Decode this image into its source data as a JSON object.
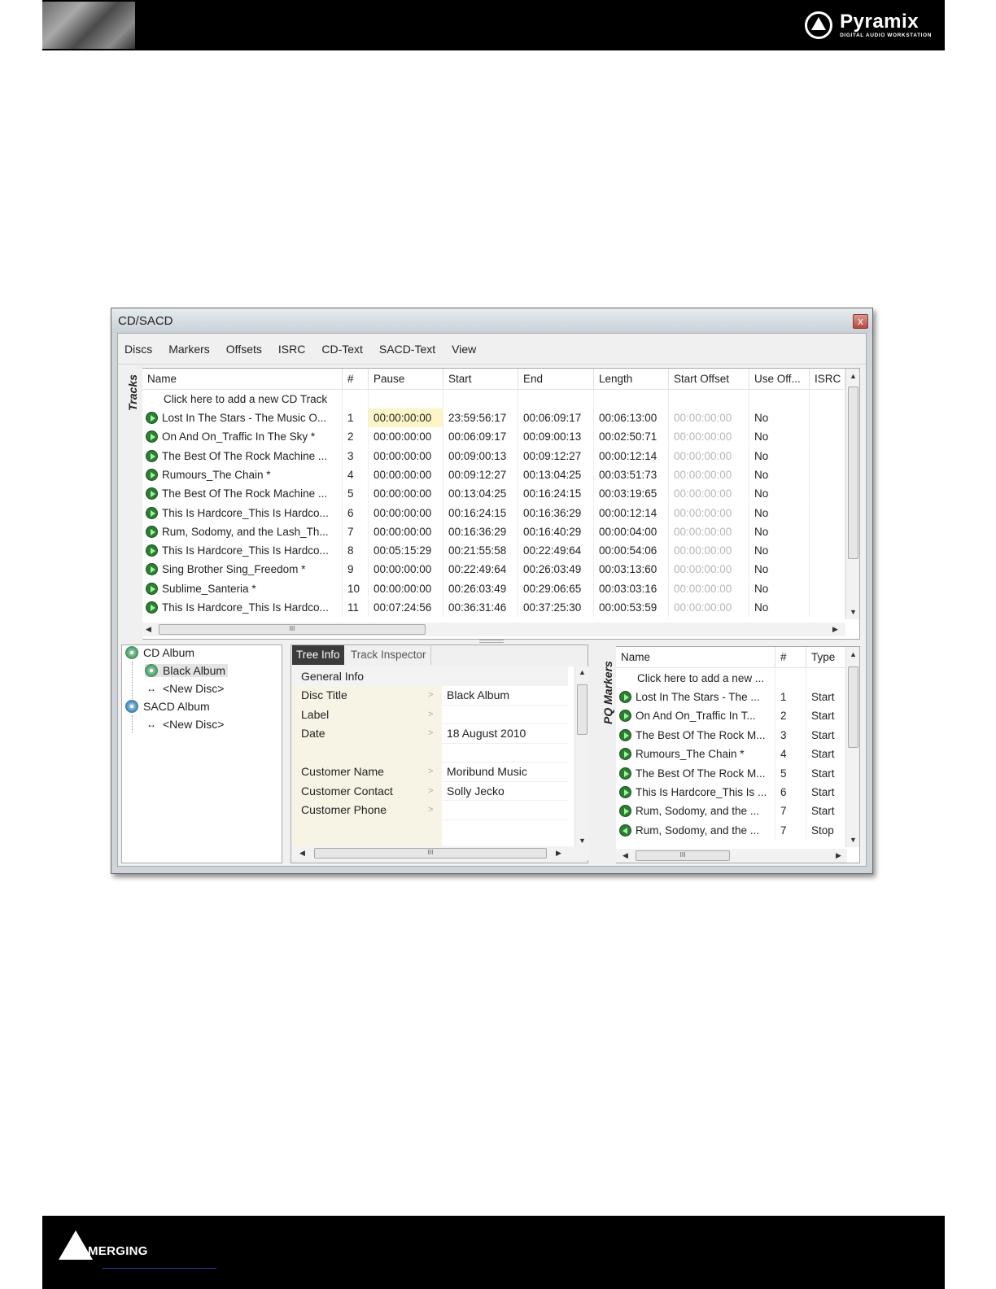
{
  "brand": {
    "product": "Pyramix",
    "product_sub": "DIGITAL AUDIO WORKSTATION",
    "company": "MERGING"
  },
  "window": {
    "title": "CD/SACD",
    "close": "x"
  },
  "menu": [
    "Discs",
    "Markers",
    "Offsets",
    "ISRC",
    "CD-Text",
    "SACD-Text",
    "View"
  ],
  "tracks": {
    "label": "Tracks",
    "columns": [
      "Name",
      "#",
      "Pause",
      "Start",
      "End",
      "Length",
      "Start Offset",
      "Use Off...",
      "ISRC"
    ],
    "add_row": "Click here to add a new CD Track",
    "rows": [
      [
        "Lost In The Stars - The Music O...",
        "1",
        "00:00:00:00",
        "23:59:56:17",
        "00:06:09:17",
        "00:06:13:00",
        "00:00:00:00",
        "No"
      ],
      [
        "On And On_Traffic In The Sky *",
        "2",
        "00:00:00:00",
        "00:06:09:17",
        "00:09:00:13",
        "00:02:50:71",
        "00:00:00:00",
        "No"
      ],
      [
        "The Best Of The Rock Machine ...",
        "3",
        "00:00:00:00",
        "00:09:00:13",
        "00:09:12:27",
        "00:00:12:14",
        "00:00:00:00",
        "No"
      ],
      [
        "Rumours_The Chain *",
        "4",
        "00:00:00:00",
        "00:09:12:27",
        "00:13:04:25",
        "00:03:51:73",
        "00:00:00:00",
        "No"
      ],
      [
        "The Best Of The Rock Machine ...",
        "5",
        "00:00:00:00",
        "00:13:04:25",
        "00:16:24:15",
        "00:03:19:65",
        "00:00:00:00",
        "No"
      ],
      [
        "This Is Hardcore_This Is Hardco...",
        "6",
        "00:00:00:00",
        "00:16:24:15",
        "00:16:36:29",
        "00:00:12:14",
        "00:00:00:00",
        "No"
      ],
      [
        "Rum, Sodomy, and the Lash_Th...",
        "7",
        "00:00:00:00",
        "00:16:36:29",
        "00:16:40:29",
        "00:00:04:00",
        "00:00:00:00",
        "No"
      ],
      [
        "This Is Hardcore_This Is Hardco...",
        "8",
        "00:05:15:29",
        "00:21:55:58",
        "00:22:49:64",
        "00:00:54:06",
        "00:00:00:00",
        "No"
      ],
      [
        "Sing Brother Sing_Freedom *",
        "9",
        "00:00:00:00",
        "00:22:49:64",
        "00:26:03:49",
        "00:03:13:60",
        "00:00:00:00",
        "No"
      ],
      [
        "Sublime_Santeria *",
        "10",
        "00:00:00:00",
        "00:26:03:49",
        "00:29:06:65",
        "00:03:03:16",
        "00:00:00:00",
        "No"
      ],
      [
        "This Is Hardcore_This Is Hardco...",
        "11",
        "00:07:24:56",
        "00:36:31:46",
        "00:37:25:30",
        "00:00:53:59",
        "00:00:00:00",
        "No"
      ]
    ],
    "hscroll_thumb": "III"
  },
  "tree": {
    "items": [
      {
        "label": "CD Album",
        "icon": "cd-album-icon"
      },
      {
        "label": "Black Album",
        "icon": "disc-icon"
      },
      {
        "label": "<New Disc>",
        "icon": "new-disc-icon"
      },
      {
        "label": "SACD Album",
        "icon": "sacd-album-icon"
      },
      {
        "label": "<New Disc>",
        "icon": "new-disc-icon"
      }
    ]
  },
  "inspector": {
    "tabs": [
      "Tree Info",
      "Track Inspector"
    ],
    "section": "General Info",
    "rows": [
      {
        "key": "Disc Title",
        "value": "Black Album"
      },
      {
        "key": "Label",
        "value": ""
      },
      {
        "key": "Date",
        "value": "18 August 2010"
      },
      {
        "key": "",
        "value": ""
      },
      {
        "key": "Customer Name",
        "value": "Moribund Music"
      },
      {
        "key": "Customer Contact",
        "value": "Solly Jecko"
      },
      {
        "key": "Customer Phone",
        "value": ""
      }
    ],
    "arrow": ">",
    "hscroll_thumb": "III"
  },
  "pq": {
    "label": "PQ Markers",
    "columns": [
      "Name",
      "#",
      "Type"
    ],
    "add_row": "Click here to add a new ...",
    "rows": [
      [
        "Lost In The Stars - The ...",
        "1",
        "Start"
      ],
      [
        "On And On_Traffic In T...",
        "2",
        "Start"
      ],
      [
        "The Best Of The Rock M...",
        "3",
        "Start"
      ],
      [
        "Rumours_The Chain *",
        "4",
        "Start"
      ],
      [
        "The Best Of The Rock M...",
        "5",
        "Start"
      ],
      [
        "This Is Hardcore_This Is ...",
        "6",
        "Start"
      ],
      [
        "Rum, Sodomy, and the ...",
        "7",
        "Start"
      ],
      [
        "Rum, Sodomy, and the ...",
        "7",
        "Stop"
      ]
    ],
    "hscroll_thumb": "III"
  },
  "colors": {
    "accent_green": "#2e7d32",
    "highlight_yellow": "#fbf5c8",
    "title_bar": "#dfe4ea"
  }
}
